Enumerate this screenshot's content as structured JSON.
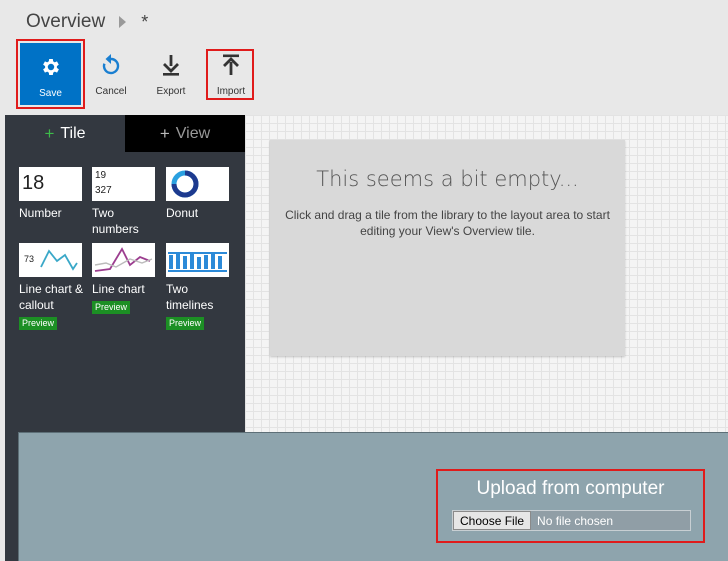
{
  "breadcrumb": {
    "title": "Overview",
    "modified_marker": "*"
  },
  "toolbar": {
    "save_label": "Save",
    "cancel_label": "Cancel",
    "export_label": "Export",
    "import_label": "Import",
    "accent_color": "#0072c6",
    "highlight_color": "#e01b1b"
  },
  "library": {
    "tabs": [
      {
        "label": "Tile",
        "icon": "plus-icon",
        "active": true
      },
      {
        "label": "View",
        "icon": "plus-icon",
        "active": false
      }
    ],
    "tiles": [
      {
        "name": "Number",
        "thumb_value": "18"
      },
      {
        "name": "Two numbers",
        "thumb_top": "19",
        "thumb_bottom": "327"
      },
      {
        "name": "Donut"
      },
      {
        "name": "Line chart & callout",
        "thumb_value": "73",
        "badge": "Preview"
      },
      {
        "name": "Line chart",
        "badge": "Preview"
      },
      {
        "name": "Two timelines",
        "badge": "Preview"
      }
    ],
    "preview_badge_color": "#1c8f24"
  },
  "canvas": {
    "empty_title": "This seems a bit empty...",
    "empty_text": "Click and drag a tile from the library to the layout area to start editing your View's Overview tile."
  },
  "upload": {
    "title": "Upload from computer",
    "choose_label": "Choose File",
    "status_text": "No file chosen"
  }
}
